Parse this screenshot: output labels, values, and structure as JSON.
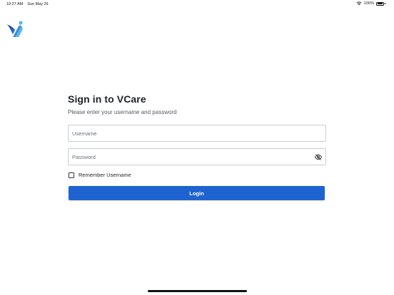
{
  "status_bar": {
    "time": "10:27 AM",
    "date": "Sun May 29",
    "battery": "100%"
  },
  "icons": {
    "wifi": "wifi-icon",
    "battery": "battery-icon",
    "logo": "vcare-logo",
    "password_toggle": "eye-off-icon"
  },
  "colors": {
    "accent": "#1e63d0",
    "logo_dark": "#1a4fa3",
    "logo_light": "#5db7e8"
  },
  "login": {
    "title": "Sign in to VCare",
    "subtitle": "Please enter your username and password",
    "username_placeholder": "Username",
    "username_value": "",
    "password_placeholder": "Password",
    "password_value": "",
    "remember_label": "Remember Username",
    "remember_checked": false,
    "submit_label": "Login"
  }
}
